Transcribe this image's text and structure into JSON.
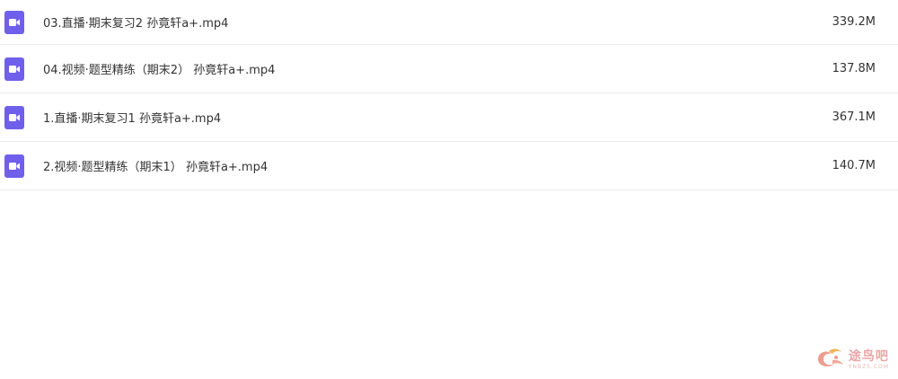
{
  "files": [
    {
      "name": "03.直播·期末复习2 孙竟轩a+.mp4",
      "size": "339.2M",
      "icon": "video-file-icon"
    },
    {
      "name": "04.视频·题型精练（期末2） 孙竟轩a+.mp4",
      "size": "137.8M",
      "icon": "video-file-icon"
    },
    {
      "name": "1.直播·期末复习1 孙竟轩a+.mp4",
      "size": "367.1M",
      "icon": "video-file-icon"
    },
    {
      "name": "2.视频·题型精练（期末1） 孙竟轩a+.mp4",
      "size": "140.7M",
      "icon": "video-file-icon"
    }
  ],
  "watermark": {
    "cn": "途鸟吧",
    "en": "YNBZS.COM"
  },
  "colors": {
    "icon_bg": "#6f5fea",
    "divider": "#ececec",
    "text": "#333333",
    "watermark": "#e9a6a6"
  }
}
